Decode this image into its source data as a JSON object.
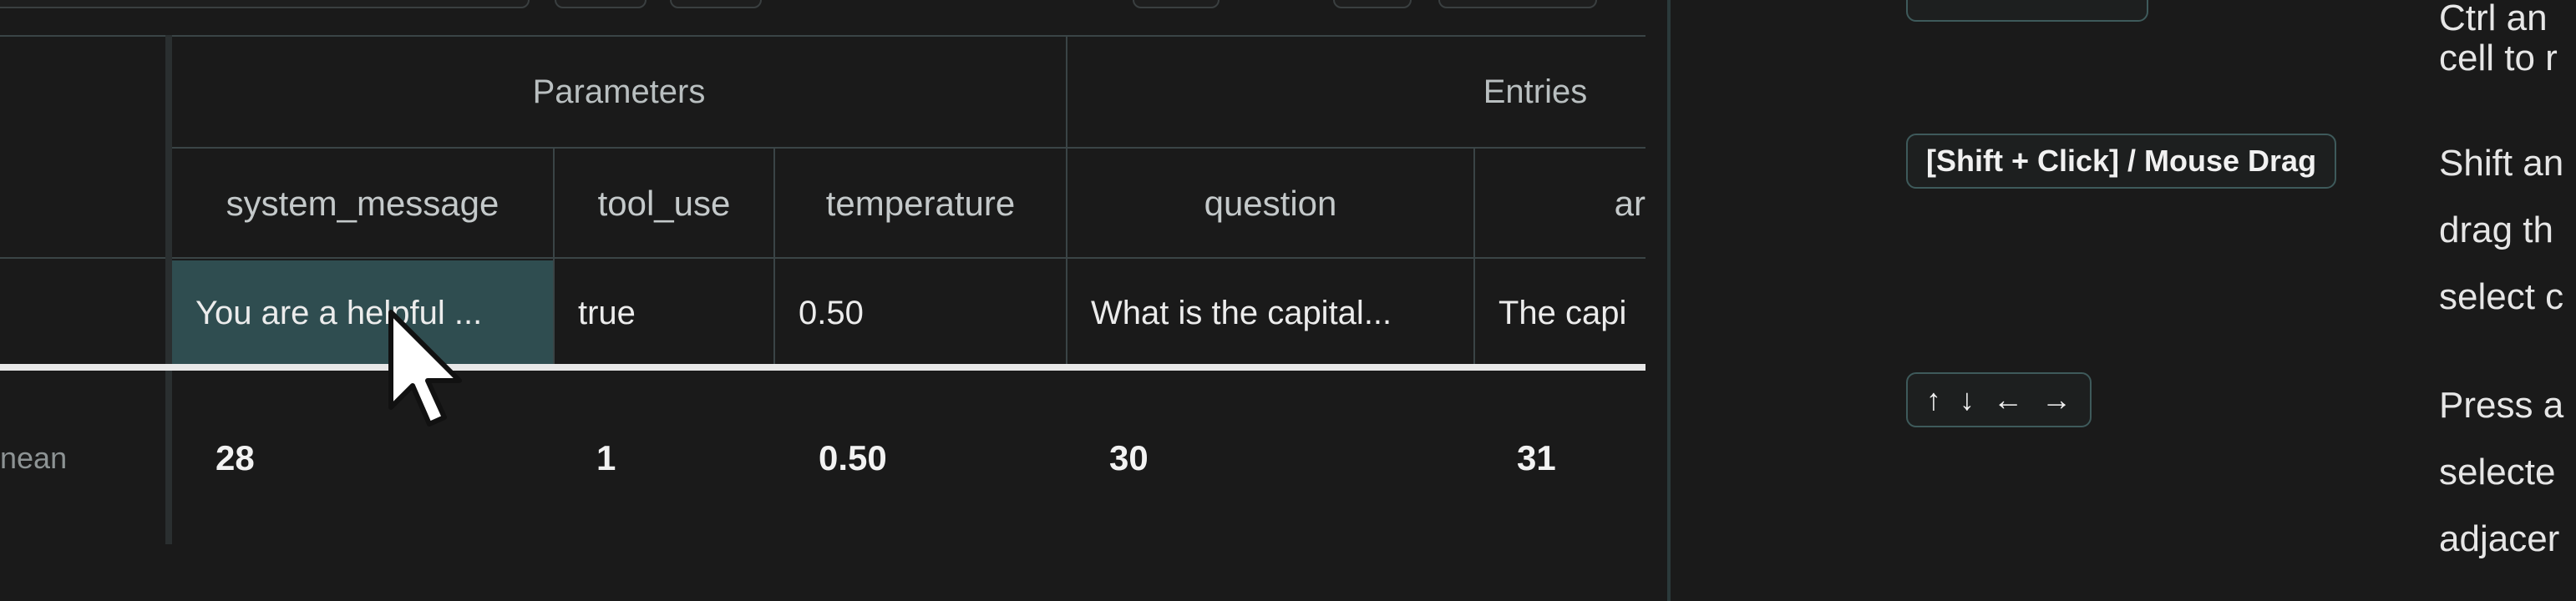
{
  "table": {
    "groups": {
      "parameters": "Parameters",
      "entries": "Entries"
    },
    "columns": {
      "system_message": "system_message",
      "tool_use": "tool_use",
      "temperature": "temperature",
      "question": "question",
      "answer_partial": "ar"
    },
    "row": {
      "system_message": "You are a helpful ...",
      "tool_use": "true",
      "temperature": "0.50",
      "question": "What is the capital...",
      "answer": "The capi"
    },
    "stats": {
      "label": "nean",
      "system_message": "28",
      "tool_use": "1",
      "temperature": "0.50",
      "question": "30",
      "answer": "31"
    }
  },
  "help": {
    "shortcuts": [
      {
        "keys": "[Shift + Click] / Mouse Drag",
        "lines": [
          "Shift an",
          "drag th",
          "select c"
        ]
      },
      {
        "keys_icons": [
          "arrow-up-icon",
          "arrow-down-icon",
          "arrow-left-icon",
          "arrow-right-icon"
        ],
        "keys_glyphs": [
          "↑",
          "↓",
          "←",
          "→"
        ],
        "lines": [
          "Press a",
          "selecte",
          "adjacer"
        ]
      }
    ],
    "top_partial_lines": [
      "Ctrl an",
      "cell to r"
    ]
  },
  "colors": {
    "selected_cell": "#2f4d50",
    "divider": "#2b3a3b",
    "badge_border": "#3e5a5b"
  }
}
